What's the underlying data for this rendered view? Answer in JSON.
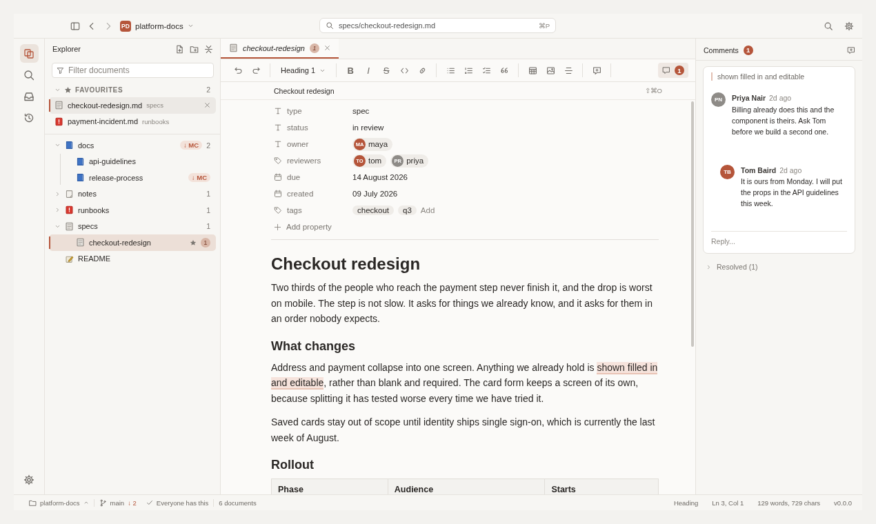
{
  "topbar": {
    "workspace_initials": "PD",
    "workspace": "platform-docs",
    "search": "specs/checkout-redesign.md",
    "search_shortcut": "⌘P"
  },
  "explorer": {
    "title": "Explorer",
    "filter_placeholder": "Filter documents",
    "favourites": {
      "label": "FAVOURITES",
      "count": "2",
      "expanded": true,
      "items": [
        {
          "name": "checkout-redesign.md",
          "folder": "specs",
          "kind": "page",
          "selected": true
        },
        {
          "name": "payment-incident.md",
          "folder": "runbooks",
          "kind": "alert",
          "selected": false
        }
      ]
    },
    "tree": [
      {
        "name": "docs",
        "kind": "book",
        "expanded": true,
        "badge": "↓ MC",
        "count": "2",
        "selected": false,
        "children": [
          {
            "name": "api-guidelines",
            "kind": "book",
            "selected": false
          },
          {
            "name": "release-process",
            "kind": "book",
            "badge": "↓ MC",
            "selected": false
          }
        ]
      },
      {
        "name": "notes",
        "kind": "note",
        "expanded": false,
        "count": "1",
        "selected": false
      },
      {
        "name": "runbooks",
        "kind": "alert",
        "expanded": false,
        "count": "1",
        "selected": false
      },
      {
        "name": "specs",
        "kind": "page",
        "expanded": true,
        "count": "1",
        "selected": false,
        "children": [
          {
            "name": "checkout-redesign",
            "kind": "page",
            "starred": true,
            "comments": "1",
            "selected": true
          }
        ]
      },
      {
        "name": "README",
        "kind": "readme",
        "selected": false
      }
    ]
  },
  "tab": {
    "title": "checkout-redesign",
    "count": "1",
    "selected": true
  },
  "toolbar": {
    "block_style": "Heading 1",
    "format": [
      {
        "kind": "bold",
        "label": "B"
      },
      {
        "kind": "italic",
        "label": "I"
      },
      {
        "kind": "strike",
        "label": "S"
      }
    ],
    "comments_count": "1"
  },
  "breadcrumb": {
    "title": "Checkout redesign",
    "shortcut": "⇧⌘O"
  },
  "properties": [
    {
      "kind": "text",
      "name": "type",
      "value": "spec"
    },
    {
      "kind": "text",
      "name": "status",
      "value": "in review"
    },
    {
      "kind": "owner",
      "name": "owner",
      "people": [
        {
          "initials": "MA",
          "name": "maya",
          "color": "#b5553a"
        }
      ]
    },
    {
      "kind": "reviewers",
      "name": "reviewers",
      "people": [
        {
          "initials": "TO",
          "name": "tom",
          "color": "#b5553a"
        },
        {
          "initials": "PR",
          "name": "priya",
          "color": "#8e8b87"
        }
      ]
    },
    {
      "kind": "date",
      "name": "due",
      "value": "14 August 2026"
    },
    {
      "kind": "date",
      "name": "created",
      "value": "09 July 2026"
    },
    {
      "kind": "tags",
      "name": "tags",
      "tags": [
        "checkout",
        "q3"
      ],
      "add": "Add"
    }
  ],
  "add_property": "Add property",
  "blocks": [
    {
      "kind": "h1",
      "text": "Checkout redesign"
    },
    {
      "kind": "p",
      "text": "Two thirds of the people who reach the payment step never finish it, and the drop is worst on mobile. The step is not slow. It asks for things we already know, and it asks for them in an order nobody expects."
    },
    {
      "kind": "h2",
      "text": "What changes"
    },
    {
      "kind": "p",
      "text": "Address and payment collapse into one screen. Anything we already hold is ",
      "highlight": "shown filled in and editable",
      "after": ", rather than blank and required. The card form keeps a screen of its own, because splitting it has tested worse every time we have tried it."
    },
    {
      "kind": "p",
      "text": "Saved cards stay out of scope until identity ships single sign-on, which is currently the last week of August."
    },
    {
      "kind": "h2",
      "text": "Rollout"
    },
    {
      "kind": "table",
      "columns": [
        "Phase",
        "Audience",
        "Starts"
      ]
    }
  ],
  "comments": {
    "title": "Comments",
    "count": "1",
    "quote": "shown filled in and editable",
    "thread": [
      {
        "initials": "PN",
        "author": "Priya Nair",
        "time": "2d ago",
        "text": "Billing already does this and the component is theirs. Ask Tom before we build a second one.",
        "color": "#8e8b87",
        "replies": [
          {
            "initials": "TB",
            "author": "Tom Baird",
            "time": "2d ago",
            "text": "It is ours from Monday. I will put the props in the API guidelines this week.",
            "color": "#b5553a"
          }
        ]
      }
    ],
    "reply_placeholder": "Reply...",
    "resolved": "Resolved (1)",
    "resolved_expanded": false
  },
  "status_bar": {
    "workspace": "platform-docs",
    "branch": "main",
    "behind": "↓ 2",
    "sync": "Everyone has this",
    "documents": "6 documents",
    "block": "Heading",
    "position": "Ln 3, Col 1",
    "counts": "129 words, 729 chars",
    "version": "v0.0.0"
  }
}
